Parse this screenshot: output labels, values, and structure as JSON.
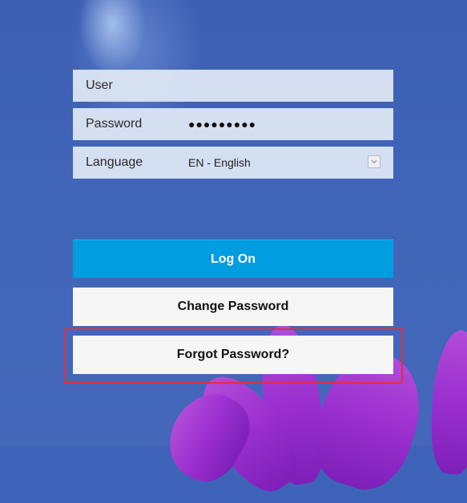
{
  "login_form": {
    "user_label": "User",
    "user_value": "",
    "password_label": "Password",
    "password_value": "●●●●●●●●●",
    "language_label": "Language",
    "language_value": "EN - English"
  },
  "buttons": {
    "log_on_label": "Log On",
    "change_password_label": "Change Password",
    "forgot_password_label": "Forgot Password?"
  },
  "icons": {
    "language_dropdown": "chevron-down-icon"
  },
  "colors": {
    "primary_button": "#009de0",
    "secondary_button": "#f6f6f6",
    "background": "#3f63b8",
    "highlight": "#e0303c",
    "flower": "#9a2fcf"
  }
}
